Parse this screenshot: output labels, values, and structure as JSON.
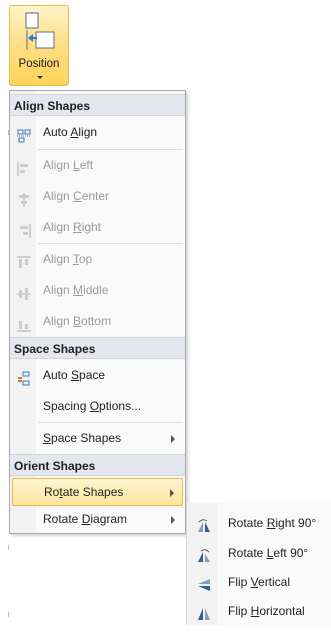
{
  "ribbon": {
    "position_label": "Position"
  },
  "menu": {
    "align_header": "Align Shapes",
    "auto_align": {
      "pre": "Auto ",
      "key": "A",
      "post": "lign"
    },
    "align_left": {
      "pre": "Align ",
      "key": "L",
      "post": "eft"
    },
    "align_center": {
      "pre": "Align ",
      "key": "C",
      "post": "enter"
    },
    "align_right": {
      "pre": "Align ",
      "key": "R",
      "post": "ight"
    },
    "align_top": {
      "pre": "Align ",
      "key": "T",
      "post": "op"
    },
    "align_middle": {
      "pre": "Align ",
      "key": "M",
      "post": "iddle"
    },
    "align_bottom": {
      "pre": "Align ",
      "key": "B",
      "post": "ottom"
    },
    "space_header": "Space Shapes",
    "auto_space": {
      "pre": "Auto ",
      "key": "S",
      "post": "pace"
    },
    "spacing_options": {
      "pre": "Spacing ",
      "key": "O",
      "post": "ptions..."
    },
    "space_shapes": {
      "pre": "",
      "key": "S",
      "post": "pace Shapes"
    },
    "orient_header": "Orient Shapes",
    "rotate_shapes": {
      "pre": "Ro",
      "key": "t",
      "post": "ate Shapes"
    },
    "rotate_diagram": {
      "pre": "Rotate ",
      "key": "D",
      "post": "iagram"
    }
  },
  "submenu": {
    "rotate_right": {
      "pre": "Rotate ",
      "key": "R",
      "post": "ight 90°"
    },
    "rotate_left": {
      "pre": "Rotate ",
      "key": "L",
      "post": "eft 90°"
    },
    "flip_vertical": {
      "pre": "Flip ",
      "key": "V",
      "post": "ertical"
    },
    "flip_horizontal": {
      "pre": "Flip ",
      "key": "H",
      "post": "orizontal"
    }
  },
  "colors": {
    "highlight": "#ffe39a",
    "header_bg": "#e4e8ee",
    "disabled_text": "#9a9a9a",
    "icon_blue": "#3a78c4"
  }
}
